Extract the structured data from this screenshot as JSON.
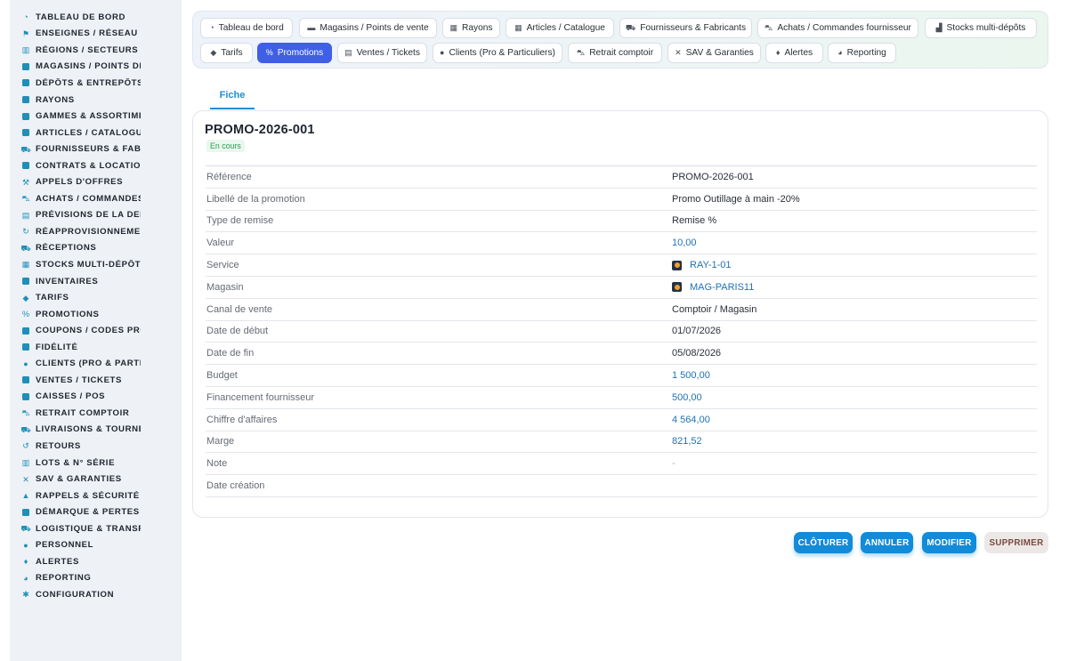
{
  "sidebar": {
    "items": [
      {
        "label": "Tableau de bord",
        "icon": "dashboard-icon"
      },
      {
        "label": "Enseignes / Réseau",
        "icon": "flag-icon"
      },
      {
        "label": "Régions / Secteurs",
        "icon": "map-icon"
      },
      {
        "label": "Magasins / Points de v",
        "icon": "store-icon"
      },
      {
        "label": "Dépôts & Entrepôts",
        "icon": "warehouse-icon"
      },
      {
        "label": "Rayons",
        "icon": "shelf-icon"
      },
      {
        "label": "Gammes & Assortiment",
        "icon": "list-icon"
      },
      {
        "label": "Articles / Catalogue",
        "icon": "catalog-icon"
      },
      {
        "label": "Fournisseurs & Fabri",
        "icon": "truck-icon"
      },
      {
        "label": "Contrats & Location",
        "icon": "contract-icon"
      },
      {
        "label": "Appels d'offres",
        "icon": "gavel-icon"
      },
      {
        "label": "Achats / Commandes F",
        "icon": "cart-icon"
      },
      {
        "label": "Prévisions de la dema",
        "icon": "chart-icon"
      },
      {
        "label": "Réapprovisionnement",
        "icon": "refresh-icon"
      },
      {
        "label": "Réceptions",
        "icon": "dolly-icon"
      },
      {
        "label": "Stocks multi-dépôts",
        "icon": "boxes-icon"
      },
      {
        "label": "Inventaires",
        "icon": "inventory-icon"
      },
      {
        "label": "Tarifs",
        "icon": "tag-icon"
      },
      {
        "label": "Promotions",
        "icon": "percent-icon"
      },
      {
        "label": "Coupons / Codes prom",
        "icon": "ticket-icon"
      },
      {
        "label": "Fidélité",
        "icon": "card-icon"
      },
      {
        "label": "Clients (Pro & Particu",
        "icon": "user-icon"
      },
      {
        "label": "Ventes / Tickets",
        "icon": "receipt-icon"
      },
      {
        "label": "Caisses / POS",
        "icon": "register-icon"
      },
      {
        "label": "Retrait comptoir",
        "icon": "car-icon"
      },
      {
        "label": "Livraisons & Tournées",
        "icon": "delivery-icon"
      },
      {
        "label": "Retours",
        "icon": "undo-icon"
      },
      {
        "label": "Lots & N° série",
        "icon": "barcode-icon"
      },
      {
        "label": "SAV & Garanties",
        "icon": "tools-icon"
      },
      {
        "label": "Rappels & Sécurité",
        "icon": "warning-icon"
      },
      {
        "label": "Démarque & Pertes",
        "icon": "trash-icon"
      },
      {
        "label": "Logistique & Transpo",
        "icon": "logistics-icon"
      },
      {
        "label": "Personnel",
        "icon": "users-icon"
      },
      {
        "label": "Alertes",
        "icon": "bell-icon"
      },
      {
        "label": "Reporting",
        "icon": "pie-icon"
      },
      {
        "label": "Configuration",
        "icon": "gear-icon"
      }
    ]
  },
  "tabs": [
    {
      "label": "Tableau de bord",
      "icon": "dashboard-icon"
    },
    {
      "label": "Magasins / Points de vente",
      "icon": "store-icon"
    },
    {
      "label": "Rayons",
      "icon": "shelf-icon"
    },
    {
      "label": "Articles / Catalogue",
      "icon": "catalog-icon"
    },
    {
      "label": "Fournisseurs & Fabricants",
      "icon": "truck-icon"
    },
    {
      "label": "Achats / Commandes fournisseur",
      "icon": "cart-icon"
    },
    {
      "label": "Stocks multi-dépôts",
      "icon": "boxes-icon"
    },
    {
      "label": "Tarifs",
      "icon": "tag-icon"
    },
    {
      "label": "Promotions",
      "icon": "percent-icon"
    },
    {
      "label": "Ventes / Tickets",
      "icon": "receipt-icon"
    },
    {
      "label": "Clients (Pro & Particuliers)",
      "icon": "user-icon"
    },
    {
      "label": "Retrait comptoir",
      "icon": "car-icon"
    },
    {
      "label": "SAV & Garanties",
      "icon": "tools-icon"
    },
    {
      "label": "Alertes",
      "icon": "bell-icon"
    },
    {
      "label": "Reporting",
      "icon": "pie-icon"
    }
  ],
  "active_tab": "Promotions",
  "subtab": {
    "label": "Fiche"
  },
  "record": {
    "title": "PROMO-2026-001",
    "status": "En cours",
    "fields": [
      {
        "label": "Référence",
        "value": "PROMO-2026-001"
      },
      {
        "label": "Libellé de la promotion",
        "value": "Promo Outillage à main -20%"
      },
      {
        "label": "Type de remise",
        "value": "Remise %"
      },
      {
        "label": "Valeur",
        "value": "10,00"
      },
      {
        "label": "Service",
        "value": "RAY-1-01"
      },
      {
        "label": "Magasin",
        "value": "MAG-PARIS11"
      },
      {
        "label": "Canal de vente",
        "value": "Comptoir / Magasin"
      },
      {
        "label": "Date de début",
        "value": "01/07/2026"
      },
      {
        "label": "Date de fin",
        "value": "05/08/2026"
      },
      {
        "label": "Budget",
        "value": "1 500,00"
      },
      {
        "label": "Financement fournisseur",
        "value": "500,00"
      },
      {
        "label": "Chiffre d'affaires",
        "value": "4 564,00"
      },
      {
        "label": "Marge",
        "value": "821,52"
      },
      {
        "label": "Note",
        "value": "-"
      },
      {
        "label": "Date création",
        "value": ""
      }
    ]
  },
  "actions": {
    "close": "CLÔTURER",
    "cancel": "ANNULER",
    "edit": "MODIFIER",
    "delete": "SUPPRIMER"
  },
  "colors": {
    "accent": "#138bd8",
    "active_tab": "#3f5fe6",
    "status_green": "#2f9b56",
    "link": "#1f72b8"
  }
}
